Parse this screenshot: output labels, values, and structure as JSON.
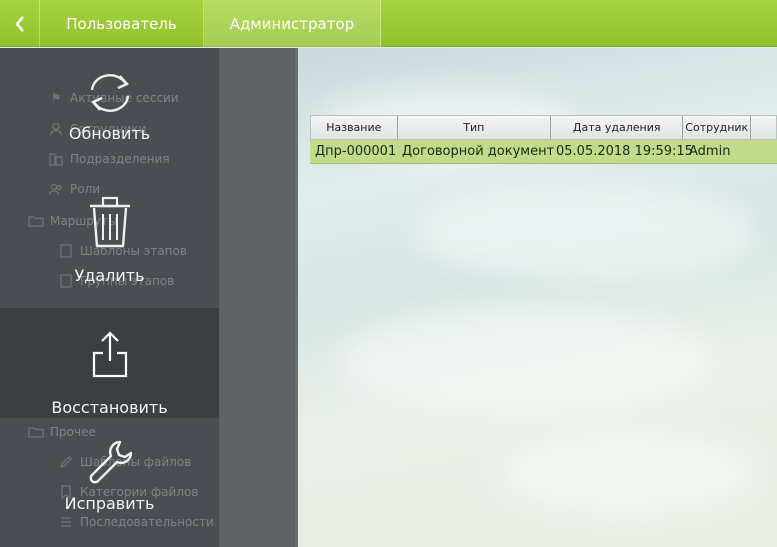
{
  "header": {
    "back_icon": "chevron-left-icon",
    "tabs": [
      {
        "label": "Пользователь"
      },
      {
        "label": "Администратор"
      }
    ]
  },
  "sidebar": {
    "items": [
      {
        "label": "Активные сессии",
        "icon": "flag-icon"
      },
      {
        "label": "Сотрудники",
        "icon": "user-icon"
      },
      {
        "label": "Подразделения",
        "icon": "building-icon"
      },
      {
        "label": "Роли",
        "icon": "users-icon"
      },
      {
        "label": "Маршруты",
        "icon": "folder-icon"
      },
      {
        "label": "Шаблоны этапов",
        "icon": "template-icon"
      },
      {
        "label": "Группы этапов",
        "icon": "template-icon"
      },
      {
        "label": "Прочее",
        "icon": "folder-icon"
      },
      {
        "label": "Шаблоны файлов",
        "icon": "pencil-icon"
      },
      {
        "label": "Категории файлов",
        "icon": "bookmark-icon"
      },
      {
        "label": "Последовательности",
        "icon": "list-icon"
      }
    ]
  },
  "actions": [
    {
      "label": "Обновить",
      "icon": "refresh-icon"
    },
    {
      "label": "Удалить",
      "icon": "trash-icon"
    },
    {
      "label": "Восстановить",
      "icon": "share-icon",
      "selected": true
    },
    {
      "label": "Исправить",
      "icon": "wrench-icon"
    }
  ],
  "table": {
    "columns": [
      "Название",
      "Тип",
      "Дата удаления",
      "Сотрудник",
      ""
    ],
    "rows": [
      {
        "name": "Дпр-000001",
        "type": "Договорной документ",
        "deleted": "05.05.2018 19:59:15",
        "employee": "Admin"
      }
    ]
  },
  "colors": {
    "accent": "#9dcc3a",
    "selected_row": "#c3da8a",
    "sidebar_bg": "#4a4e52",
    "action_selected": "#3c3f42"
  }
}
